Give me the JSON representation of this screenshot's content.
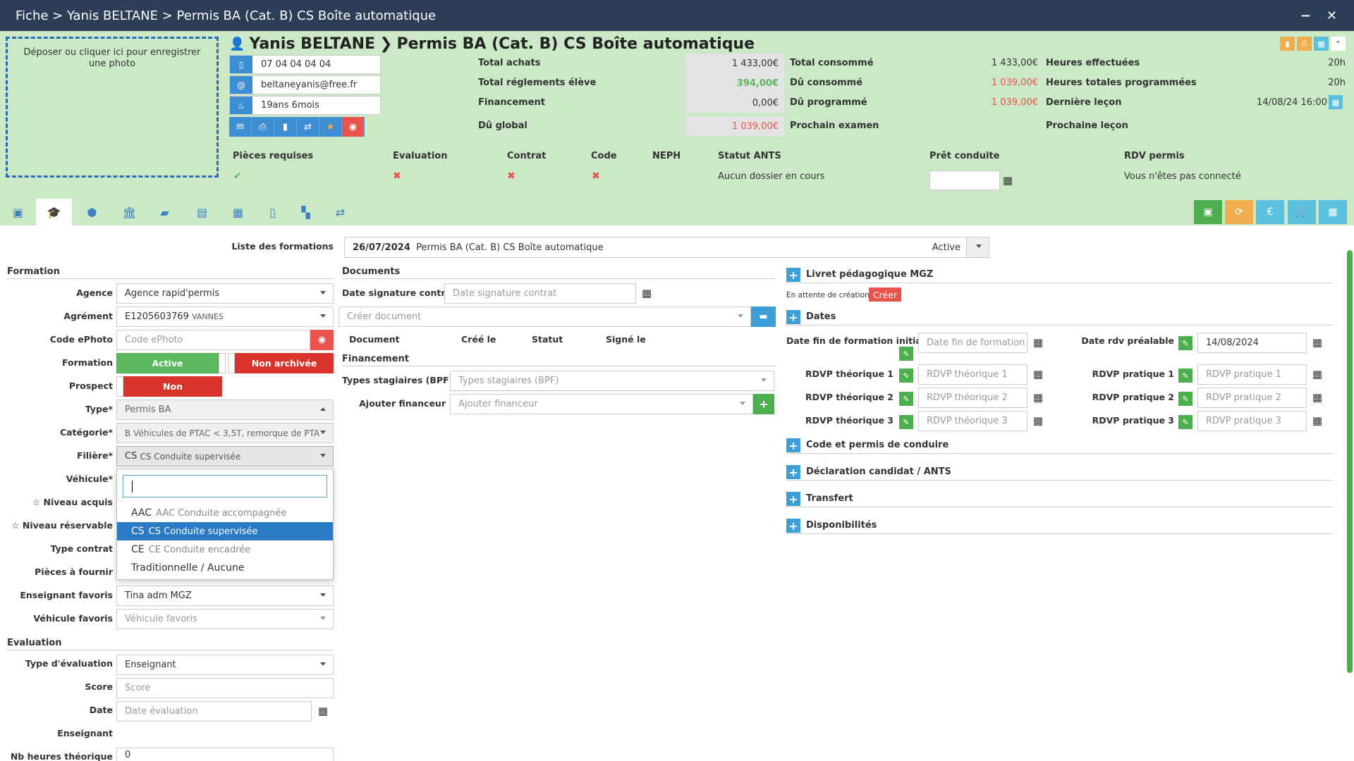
{
  "titlebar": {
    "breadcrumb": "Fiche > Yanis BELTANE > Permis BA (Cat. B) CS Boîte automatique",
    "minimize": "−",
    "close": "✕"
  },
  "header": {
    "dropzone": "Déposer ou cliquer ici pour enregistrer une photo",
    "person_name": "Yanis BELTANE",
    "formation_title": "Permis BA (Cat. B) CS Boîte automatique",
    "phone": "07 04 04 04 04",
    "email": "beltaneyanis@free.fr",
    "age": "19ans 6mois",
    "stats": {
      "total_achats_label": "Total achats",
      "total_achats": "1 433,00€",
      "total_reglements_label": "Total réglements élève",
      "total_reglements": "394,00€",
      "financement_label": "Financement",
      "financement": "0,00€",
      "du_global_label": "Dû global",
      "du_global": "1 039,00€",
      "total_consomme_label": "Total consommé",
      "total_consomme": "1 433,00€",
      "du_consomme_label": "Dû consommé",
      "du_consomme": "1 039,00€",
      "du_programme_label": "Dû programmé",
      "du_programme": "1 039,00€",
      "prochain_examen_label": "Prochain examen",
      "heures_effectuees_label": "Heures effectuées",
      "heures_effectuees": "20h",
      "heures_programmees_label": "Heures totales programmées",
      "heures_programmees": "20h",
      "derniere_lecon_label": "Dernière leçon",
      "derniere_lecon": "14/08/24 16:00",
      "prochaine_lecon_label": "Prochaine leçon"
    },
    "requirements": {
      "pieces_label": "Pièces requises",
      "evaluation_label": "Evaluation",
      "contrat_label": "Contrat",
      "code_label": "Code",
      "neph_label": "NEPH",
      "statut_ants_label": "Statut ANTS",
      "statut_ants": "Aucun dossier en cours",
      "pret_conduite_label": "Prêt conduite",
      "rdv_permis_label": "RDV permis",
      "rdv_permis": "Vous n'êtes pas connecté",
      "check": "✔",
      "cross": "✖"
    }
  },
  "formations": {
    "label": "Liste des formations",
    "date": "26/07/2024",
    "name": "Permis BA (Cat. B) CS Boîte automatique",
    "status": "Active"
  },
  "formation": {
    "section": "Formation",
    "agence_label": "Agence",
    "agence": "Agence rapid'permis",
    "agrement_label": "Agrément",
    "agrement": "E1205603769",
    "agrement_city": "VANNES",
    "ephoto_label": "Code ePhoto",
    "ephoto_ph": "Code ePhoto",
    "formation_label": "Formation",
    "active": "Active",
    "non_archivee": "Non archivée",
    "prospect_label": "Prospect",
    "non": "Non",
    "type_label": "Type*",
    "type": "Permis BA",
    "categorie_label": "Catégorie*",
    "categorie_code": "B",
    "categorie": "B Véhicules de PTAC < 3,5T, remorque de PTA",
    "filiere_label": "Filière*",
    "filiere_code": "CS",
    "filiere": "CS Conduite supervisée",
    "vehicule_label": "Véhicule*",
    "niveau_acquis_label": "☆ Niveau acquis",
    "niveau_reservable_label": "☆ Niveau réservable",
    "type_contrat_label": "Type contrat",
    "pieces_label": "Pièces à fournir",
    "enseignant_fav_label": "Enseignant favoris",
    "enseignant_fav": "Tina adm MGZ",
    "vehicule_fav_label": "Véhicule favoris",
    "vehicule_fav_ph": "Véhicule favoris"
  },
  "dropdown": {
    "options": [
      {
        "code": "AAC",
        "label": "AAC Conduite accompagnée"
      },
      {
        "code": "CS",
        "label": "CS Conduite supervisée"
      },
      {
        "code": "CE",
        "label": "CE Conduite encadrée"
      },
      {
        "code": "Traditionnelle / Aucune",
        "label": ""
      }
    ]
  },
  "evaluation": {
    "section": "Evaluation",
    "type_label": "Type d'évaluation",
    "type": "Enseignant",
    "score_label": "Score",
    "score_ph": "Score",
    "date_label": "Date",
    "date_ph": "Date évaluation",
    "enseignant_label": "Enseignant",
    "nb_heures_label": "Nb heures théorique",
    "nb_heures": "0"
  },
  "documents": {
    "section": "Documents",
    "date_sig_label": "Date signature contrat",
    "date_sig_ph": "Date signature contrat",
    "creer_doc_ph": "Créer document",
    "col_document": "Document",
    "col_cree": "Créé le",
    "col_statut": "Statut",
    "col_signe": "Signé le"
  },
  "financement": {
    "section": "Financement",
    "types_label": "Types stagiaires (BPF)",
    "types_ph": "Types stagiaires (BPF)",
    "ajouter_label": "Ajouter financeur",
    "ajouter_ph": "Ajouter financeur"
  },
  "right": {
    "livret": "Livret pédagogique MGZ",
    "en_attente": "En attente de création",
    "creer": "Créer",
    "dates": "Dates",
    "date_fin_label": "Date fin de formation initiale",
    "date_fin_ph": "Date fin de formation",
    "date_rdv_label": "Date rdv préalable",
    "date_rdv": "14/08/2024",
    "rdvp_t1_label": "RDVP théorique 1",
    "rdvp_t1_ph": "RDVP théorique 1",
    "rdvp_t2_label": "RDVP théorique 2",
    "rdvp_t2_ph": "RDVP théorique 2",
    "rdvp_t3_label": "RDVP théorique 3",
    "rdvp_t3_ph": "RDVP théorique 3",
    "rdvp_p1_label": "RDVP pratique 1",
    "rdvp_p1_ph": "RDVP pratique 1",
    "rdvp_p2_label": "RDVP pratique 2",
    "rdvp_p2_ph": "RDVP pratique 2",
    "rdvp_p3_label": "RDVP pratique 3",
    "rdvp_p3_ph": "RDVP pratique 3",
    "code_permis": "Code et permis de conduire",
    "declaration": "Déclaration candidat / ANTS",
    "transfert": "Transfert",
    "disponibilites": "Disponibilités"
  },
  "colors": {
    "primary": "#3c8dd3",
    "success": "#4cae4c",
    "danger": "#e9534b",
    "warning": "#f0ad4e",
    "info": "#5bc0de",
    "header_bg": "#cbe9c6",
    "titlebar": "#2c3e57"
  }
}
